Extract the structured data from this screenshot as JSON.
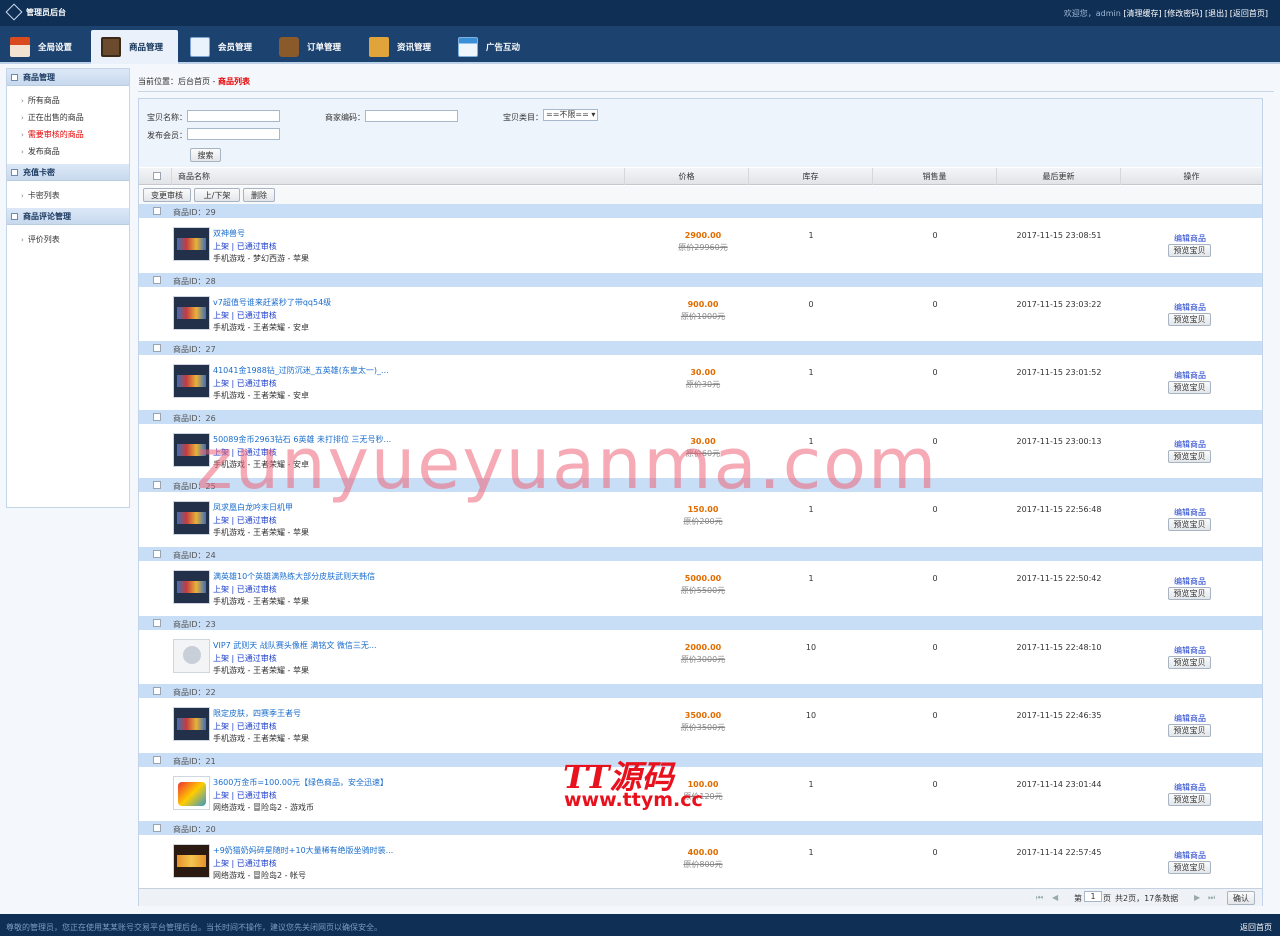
{
  "app": {
    "title": "管理员后台",
    "welcome": "欢迎您，admin",
    "links": [
      "[清理缓存]",
      "[修改密码]",
      "[退出]",
      "[返回首页]"
    ]
  },
  "nav": [
    {
      "label": "全局设置",
      "icon": "store-icon"
    },
    {
      "label": "商品管理",
      "icon": "grid-icon",
      "active": true
    },
    {
      "label": "会员管理",
      "icon": "contact-icon"
    },
    {
      "label": "订单管理",
      "icon": "wallet-icon"
    },
    {
      "label": "资讯管理",
      "icon": "bag-icon"
    },
    {
      "label": "广告互动",
      "icon": "table-icon"
    }
  ],
  "sidebar": [
    {
      "title": "商品管理",
      "items": [
        {
          "label": "所有商品"
        },
        {
          "label": "正在出售的商品"
        },
        {
          "label": "需要审核的商品",
          "highlight": true
        },
        {
          "label": "发布商品"
        }
      ]
    },
    {
      "title": "充值卡密",
      "items": [
        {
          "label": "卡密列表"
        }
      ]
    },
    {
      "title": "商品评论管理",
      "items": [
        {
          "label": "评价列表"
        }
      ]
    }
  ],
  "breadcrumb": {
    "prefix": "当前位置：",
    "home": "后台首页",
    "sep": " - ",
    "current": "商品列表"
  },
  "filter": {
    "name_label": "宝贝名称：",
    "shop_label": "商家编码：",
    "cat_label": "宝贝类目：",
    "cat_value": "==不限==",
    "member_label": "发布会员：",
    "search": "搜索"
  },
  "table": {
    "headers": [
      "商品名称",
      "价格",
      "库存",
      "销售量",
      "最后更新",
      "操作"
    ],
    "actions": [
      "变更审核",
      "上/下架",
      "删除"
    ],
    "edit_label": "编辑商品",
    "preview_label": "预览宝贝"
  },
  "products": [
    {
      "id": "商品ID：29",
      "name": "双神兽号",
      "status": "上架 | 已通过审核",
      "category": "手机游戏 - 梦幻西游 - 苹果",
      "price": "2900.00",
      "orig": "原价29960元",
      "stock": "1",
      "sold": "0",
      "updated": "2017-11-15 23:08:51",
      "thumb": "game"
    },
    {
      "id": "商品ID：28",
      "name": "v7超值号谁来赶紧秒了带qq54级",
      "status": "上架 | 已通过审核",
      "category": "手机游戏 - 王者荣耀 - 安卓",
      "price": "900.00",
      "orig": "原价1000元",
      "stock": "0",
      "sold": "0",
      "updated": "2017-11-15 23:03:22",
      "thumb": "game"
    },
    {
      "id": "商品ID：27",
      "name": "41041金1988钻_过防沉迷_五英雄(东皇太一)_...",
      "status": "上架 | 已通过审核",
      "category": "手机游戏 - 王者荣耀 - 安卓",
      "price": "30.00",
      "orig": "原价30元",
      "stock": "1",
      "sold": "0",
      "updated": "2017-11-15 23:01:52",
      "thumb": "game"
    },
    {
      "id": "商品ID：26",
      "name": "50089金币2963钻石 6英雄 未打排位 三无号秒...",
      "status": "上架 | 已通过审核",
      "category": "手机游戏 - 王者荣耀 - 安卓",
      "price": "30.00",
      "orig": "原价60元",
      "stock": "1",
      "sold": "0",
      "updated": "2017-11-15 23:00:13",
      "thumb": "game"
    },
    {
      "id": "商品ID：25",
      "name": "凤求凰白龙吟末日机甲",
      "status": "上架 | 已通过审核",
      "category": "手机游戏 - 王者荣耀 - 苹果",
      "price": "150.00",
      "orig": "原价200元",
      "stock": "1",
      "sold": "0",
      "updated": "2017-11-15 22:56:48",
      "thumb": "game"
    },
    {
      "id": "商品ID：24",
      "name": "满英雄10个英雄满熟练大部分皮肤武则天韩信",
      "status": "上架 | 已通过审核",
      "category": "手机游戏 - 王者荣耀 - 苹果",
      "price": "5000.00",
      "orig": "原价5500元",
      "stock": "1",
      "sold": "0",
      "updated": "2017-11-15 22:50:42",
      "thumb": "game"
    },
    {
      "id": "商品ID：23",
      "name": "VIP7 武则天 战队赛头像框 满铭文 微信三无...",
      "status": "上架 | 已通过审核",
      "category": "手机游戏 - 王者荣耀 - 苹果",
      "price": "2000.00",
      "orig": "原价3000元",
      "stock": "10",
      "sold": "0",
      "updated": "2017-11-15 22:48:10",
      "thumb": "tiger"
    },
    {
      "id": "商品ID：22",
      "name": "限定皮肤，四赛季王者号",
      "status": "上架 | 已通过审核",
      "category": "手机游戏 - 王者荣耀 - 苹果",
      "price": "3500.00",
      "orig": "原价3500元",
      "stock": "10",
      "sold": "0",
      "updated": "2017-11-15 22:46:35",
      "thumb": "game"
    },
    {
      "id": "商品ID：21",
      "name": "3600万金币=100.00元【绿色商品，安全迅速】",
      "status": "上架 | 已通过审核",
      "category": "网络游戏 - 冒险岛2 - 游戏币",
      "price": "100.00",
      "orig": "原价120元",
      "stock": "1",
      "sold": "0",
      "updated": "2017-11-14 23:01:44",
      "thumb": "game2"
    },
    {
      "id": "商品ID：20",
      "name": "+9奶猫奶妈碎星随时+10大量稀有绝版坐骑时装...",
      "status": "上架 | 已通过审核",
      "category": "网络游戏 - 冒险岛2 - 帐号",
      "price": "400.00",
      "orig": "原价800元",
      "stock": "1",
      "sold": "0",
      "updated": "2017-11-14 22:57:45",
      "thumb": "pet"
    }
  ],
  "pager": {
    "page_prefix": "第",
    "page": "1",
    "page_suffix": "页",
    "total": "共2页，17条数据",
    "confirm": "确认"
  },
  "footer": {
    "notice": "尊敬的管理员，您正在使用某某账号交易平台管理后台。当长时间不操作，建议您先关闭网页以确保安全。",
    "home": "返回首页"
  },
  "watermark": {
    "url": "zunyueyuanma.com",
    "brand": "TT源码",
    "site": "www.ttym.cc"
  }
}
